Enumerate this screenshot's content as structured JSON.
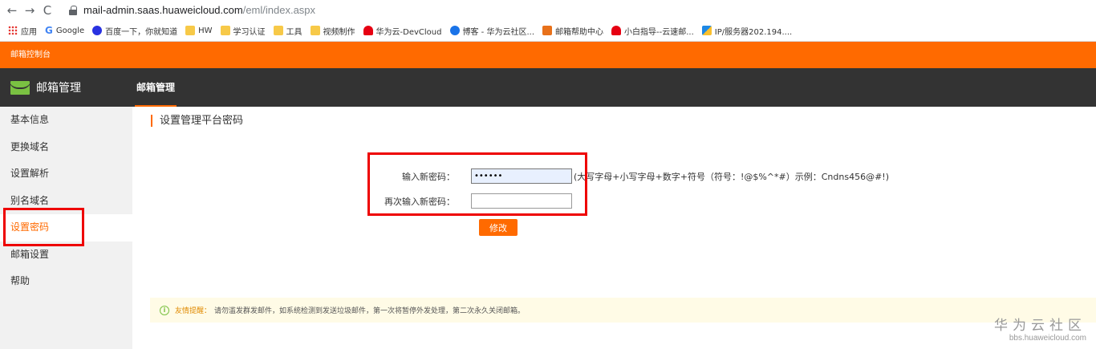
{
  "browser": {
    "nav": {
      "back": "←",
      "forward": "→",
      "reload": "C"
    },
    "url_host": "mail-admin.saas.huaweicloud.com",
    "url_path": "/eml/index.aspx",
    "bookmarks": [
      {
        "label": "应用",
        "icon": "apps-icon"
      },
      {
        "label": "Google",
        "icon": "google-icon"
      },
      {
        "label": "百度一下，你就知道",
        "icon": "baidu-icon"
      },
      {
        "label": "HW",
        "icon": "folder-icon"
      },
      {
        "label": "学习认证",
        "icon": "folder-icon"
      },
      {
        "label": "工具",
        "icon": "folder-icon"
      },
      {
        "label": "视频制作",
        "icon": "folder-icon"
      },
      {
        "label": "华为云-DevCloud",
        "icon": "huawei-icon"
      },
      {
        "label": "博客 - 华为云社区...",
        "icon": "blog-icon"
      },
      {
        "label": "邮箱帮助中心",
        "icon": "mail-icon"
      },
      {
        "label": "小白指导--云速邮...",
        "icon": "huawei-icon"
      },
      {
        "label": "IP/服务器202.194....",
        "icon": "ip-icon"
      }
    ]
  },
  "app": {
    "topbar_title": "邮箱控制台",
    "logo_text": "邮箱管理",
    "header_tab": "邮箱管理",
    "sidebar": [
      {
        "label": "基本信息",
        "active": false
      },
      {
        "label": "更换域名",
        "active": false
      },
      {
        "label": "设置解析",
        "active": false
      },
      {
        "label": "别名域名",
        "active": false
      },
      {
        "label": "设置密码",
        "active": true
      },
      {
        "label": "邮箱设置",
        "active": false
      },
      {
        "label": "帮助",
        "active": false
      }
    ],
    "section_title": "设置管理平台密码",
    "form": {
      "new_password_label": "输入新密码：",
      "new_password_value": "••••••",
      "password_hint": "(大写字母+小写字母+数字+符号（符号：!@$%^*#）示例：Cndns456@#!)",
      "confirm_password_label": "再次输入新密码：",
      "confirm_password_value": "",
      "submit_label": "修改"
    },
    "notice": {
      "icon": "info-icon",
      "title": "友情提醒：",
      "text": "请勿滥发群发邮件，如系统检测到发送垃圾邮件，第一次将暂停外发处理，第二次永久关闭邮箱。"
    },
    "watermark": {
      "cn": "华为云社区",
      "en": "bbs.huaweicloud.com"
    }
  },
  "colors": {
    "accent": "#ff6a00",
    "header_bg": "#333333",
    "sidebar_bg": "#f1f1f1",
    "highlight": "#ee0000"
  }
}
